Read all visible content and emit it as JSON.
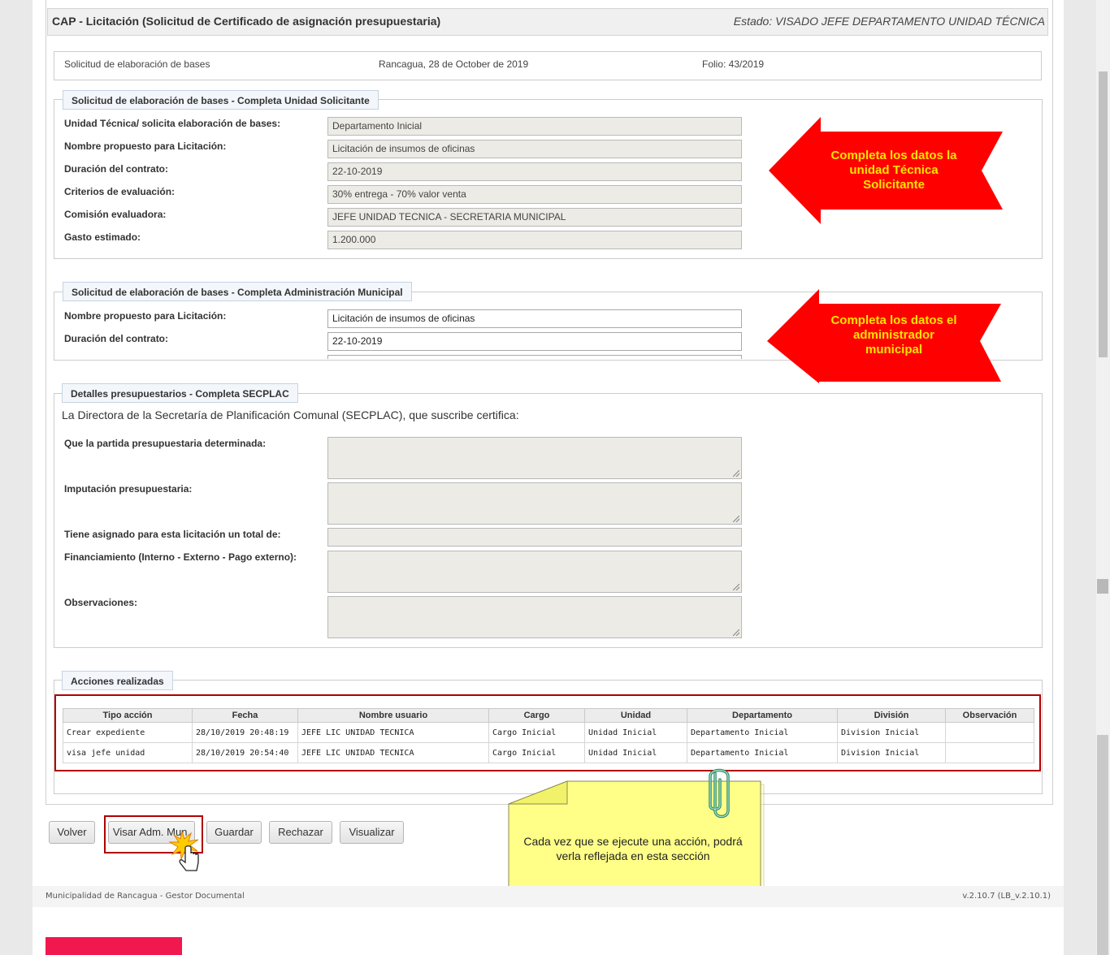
{
  "header": {
    "title": "CAP - Licitación (Solicitud de Certificado de asignación presupuestaria)",
    "state": "Estado: VISADO JEFE DEPARTAMENTO UNIDAD TÉCNICA"
  },
  "info": {
    "type": "Solicitud de elaboración de bases",
    "date": "Rancagua, 28 de October de 2019",
    "folio": "Folio: 43/2019"
  },
  "section1": {
    "legend": "Solicitud de elaboración de bases - Completa Unidad Solicitante",
    "fields": [
      {
        "label": "Unidad Técnica/ solicita elaboración de bases:",
        "value": "Departamento Inicial"
      },
      {
        "label": "Nombre propuesto para Licitación:",
        "value": "Licitación de insumos de oficinas"
      },
      {
        "label": "Duración del contrato:",
        "value": "22-10-2019"
      },
      {
        "label": "Criterios de evaluación:",
        "value": "30% entrega - 70% valor venta"
      },
      {
        "label": "Comisión evaluadora:",
        "value": "JEFE UNIDAD TECNICA - SECRETARIA MUNICIPAL"
      },
      {
        "label": "Gasto estimado:",
        "value": "1.200.000"
      }
    ],
    "callout": [
      "Completa los datos la",
      "unidad Técnica",
      "Solicitante"
    ]
  },
  "section2": {
    "legend": "Solicitud de elaboración de bases - Completa Administración Municipal",
    "fields": [
      {
        "label": "Nombre propuesto para Licitación:",
        "value": "Licitación de insumos de oficinas"
      },
      {
        "label": "Duración del contrato:",
        "value": "22-10-2019"
      }
    ],
    "callout": [
      "Completa los datos el",
      "administrador",
      "municipal"
    ]
  },
  "section3": {
    "legend": "Detalles presupuestarios - Completa SECPLAC",
    "intro": "La Directora de la Secretaría de Planificación Comunal (SECPLAC), que suscribe certifica:",
    "fields": [
      {
        "label": "Que la partida presupuestaria determinada:"
      },
      {
        "label": "Imputación presupuestaria:"
      },
      {
        "label": "Tiene asignado para esta licitación un total de:"
      },
      {
        "label": "Financiamiento (Interno - Externo - Pago externo):"
      },
      {
        "label": "Observaciones:"
      }
    ]
  },
  "actions": {
    "legend": "Acciones realizadas",
    "columns": [
      "Tipo acción",
      "Fecha",
      "Nombre usuario",
      "Cargo",
      "Unidad",
      "Departamento",
      "División",
      "Observación"
    ],
    "rows": [
      [
        "Crear expediente",
        "28/10/2019 20:48:19",
        "JEFE LIC UNIDAD TECNICA",
        "Cargo Inicial",
        "Unidad Inicial",
        "Departamento Inicial",
        "Division Inicial",
        ""
      ],
      [
        "visa jefe unidad",
        "28/10/2019 20:54:40",
        "JEFE LIC UNIDAD TECNICA",
        "Cargo Inicial",
        "Unidad Inicial",
        "Departamento Inicial",
        "Division Inicial",
        ""
      ]
    ]
  },
  "buttons": {
    "volver": "Volver",
    "visar": "Visar Adm. Mun.",
    "guardar": "Guardar",
    "rechazar": "Rechazar",
    "visualizar": "Visualizar"
  },
  "note": {
    "line1": "Cada vez que se ejecute una acción, podrá",
    "line2": "verla reflejada en esta sección"
  },
  "footer": {
    "left": "Municipalidad de Rancagua - Gestor Documental",
    "right": "v.2.10.7 (LB_v.2.10.1)"
  },
  "colors": {
    "callout_red": "#ff0000",
    "callout_text": "#ffe400",
    "note_yellow": "#ffff88",
    "highlight_border": "#b00000",
    "brand_pink": "#f0184e"
  }
}
